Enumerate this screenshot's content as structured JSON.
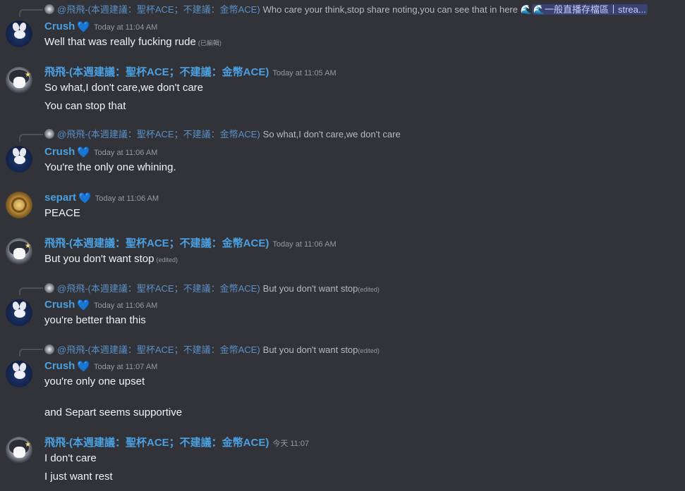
{
  "messages": [
    {
      "reply": {
        "name": "@飛飛-(本週建議：聖杯ACE；不建議：金幣ACE)",
        "text": "Who care your think,stop share noting,you can see that in  here",
        "channel": "🌊一般直播存檔區丨strea..."
      },
      "author": "Crush",
      "time": "Today at 11:04 AM",
      "lines": [
        "Well that was really fucking rude"
      ],
      "edited": "(已編輯)"
    },
    {
      "author": "飛飛-(本週建議：聖杯ACE；不建議：金幣ACE)",
      "time": "Today at 11:05 AM",
      "lines": [
        "So what,I don't care,we don't  care",
        "You can stop that"
      ]
    },
    {
      "reply": {
        "name": "@飛飛-(本週建議：聖杯ACE；不建議：金幣ACE)",
        "text": "So what,I don't care,we don't  care"
      },
      "author": "Crush",
      "time": "Today at 11:06 AM",
      "lines": [
        "You're the only one whining."
      ]
    },
    {
      "author": "separt",
      "time": "Today at 11:06 AM",
      "lines": [
        "PEACE"
      ]
    },
    {
      "author": "飛飛-(本週建議：聖杯ACE；不建議：金幣ACE)",
      "time": "Today at 11:06 AM",
      "lines": [
        "But you don't want stop"
      ],
      "edited": "(edited)"
    },
    {
      "reply": {
        "name": "@飛飛-(本週建議：聖杯ACE；不建議：金幣ACE)",
        "text": "But you don't want stop",
        "edited": "(edited)"
      },
      "author": "Crush",
      "time": "Today at 11:06 AM",
      "lines": [
        "you're better than this"
      ]
    },
    {
      "reply": {
        "name": "@飛飛-(本週建議：聖杯ACE；不建議：金幣ACE)",
        "text": "But you don't want stop",
        "edited": "(edited)"
      },
      "author": "Crush",
      "time": "Today at 11:07 AM",
      "lines": [
        "you're only one upset",
        "and Separt seems supportive"
      ]
    },
    {
      "author": "飛飛-(本週建議：聖杯ACE；不建議：金幣ACE)",
      "time": "今天 11:07",
      "lines": [
        "I don't care",
        "I just  want rest"
      ]
    }
  ],
  "colors": {
    "background": "#313338",
    "username": "#4a9fe0",
    "timestamp": "#949ba4",
    "text": "#f2f3f5",
    "reply_text": "#b5bac1"
  },
  "icons": {
    "badge": "blue-heart-icon"
  }
}
